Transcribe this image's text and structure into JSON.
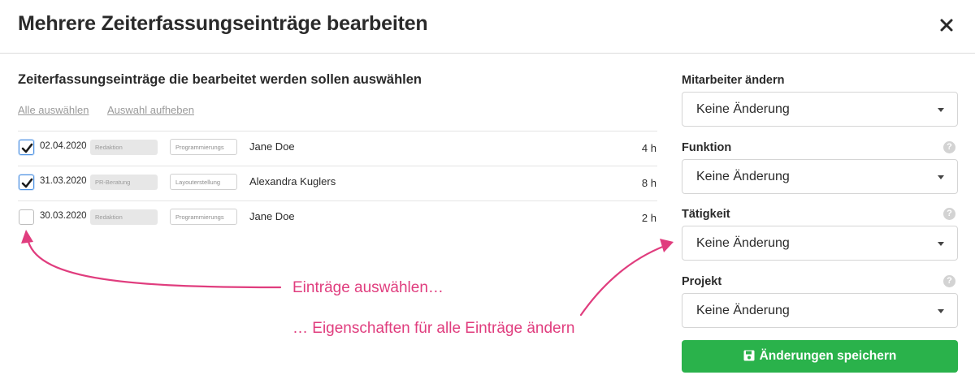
{
  "dialog": {
    "title": "Mehrere Zeiterfassungseinträge bearbeiten",
    "close_icon": "close-icon"
  },
  "left": {
    "heading": "Zeiterfassungseinträge die bearbeitet werden sollen auswählen",
    "select_all": "Alle auswählen",
    "deselect_all": "Auswahl aufheben",
    "entries": [
      {
        "checked": true,
        "date": "02.04.2020",
        "tag": "Redaktion",
        "task": "Programmierungs",
        "name": "Jane Doe",
        "hours": "4 h"
      },
      {
        "checked": true,
        "date": "31.03.2020",
        "tag": "PR-Beratung",
        "task": "Layouterstellung",
        "name": "Alexandra Kuglers",
        "hours": "8 h"
      },
      {
        "checked": false,
        "date": "30.03.2020",
        "tag": "Redaktion",
        "task": "Programmierungs",
        "name": "Jane Doe",
        "hours": "2 h"
      }
    ]
  },
  "annotations": {
    "select_hint": "Einträge auswählen…",
    "change_hint": "… Eigenschaften für alle Einträge ändern",
    "color": "#e03d7e"
  },
  "right": {
    "fields": [
      {
        "label": "Mitarbeiter ändern",
        "value": "Keine Änderung",
        "help": false
      },
      {
        "label": "Funktion",
        "value": "Keine Änderung",
        "help": true
      },
      {
        "label": "Tätigkeit",
        "value": "Keine Änderung",
        "help": true
      },
      {
        "label": "Projekt",
        "value": "Keine Änderung",
        "help": true
      }
    ],
    "help_glyph": "?",
    "save_label": "Änderungen speichern",
    "save_icon": "floppy-disk-icon",
    "save_color": "#2ab24b"
  }
}
